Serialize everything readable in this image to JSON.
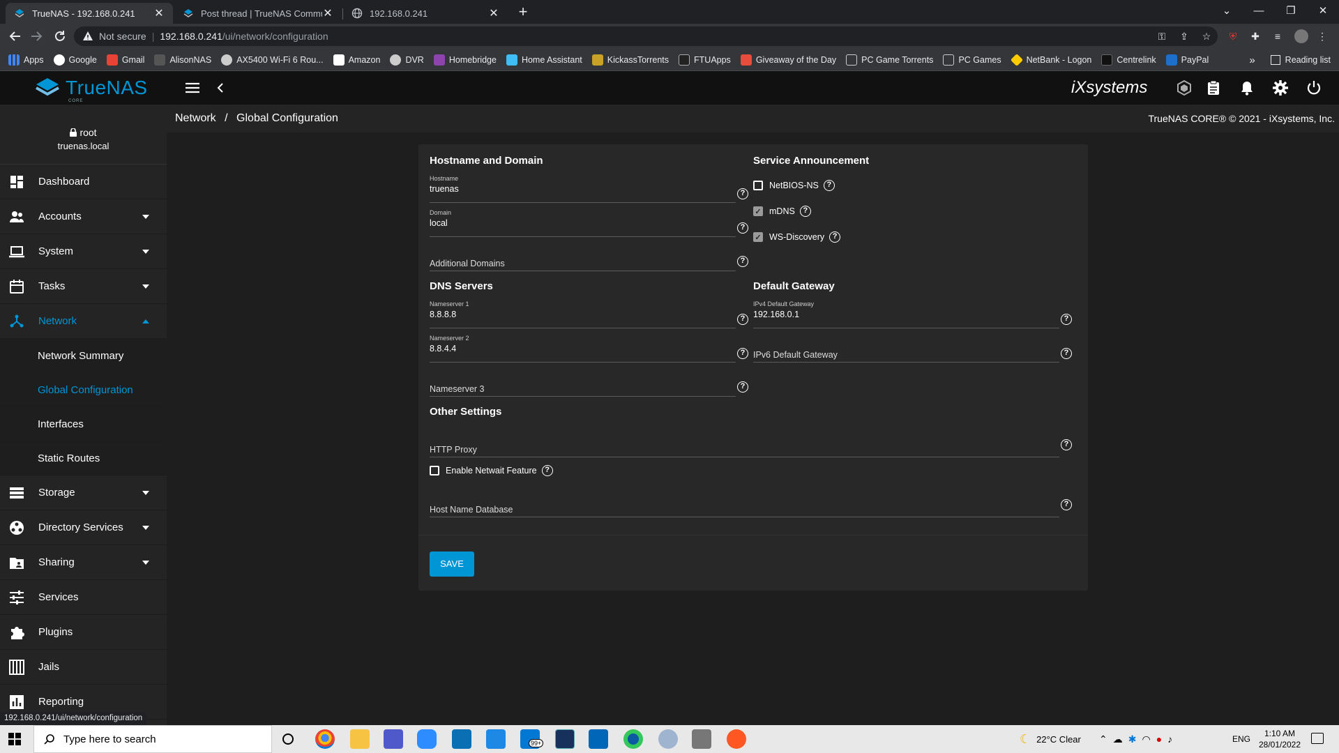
{
  "browser": {
    "tabs": [
      {
        "title": "TrueNAS - 192.168.0.241",
        "active": true
      },
      {
        "title": "Post thread | TrueNAS Communit",
        "active": false
      },
      {
        "title": "192.168.0.241",
        "active": false
      }
    ],
    "new_tab": "+",
    "address": {
      "security": "Not secure",
      "host": "192.168.0.241",
      "path": "/ui/network/configuration"
    },
    "bookmarks": [
      "Apps",
      "Google",
      "Gmail",
      "AlisonNAS",
      "AX5400 Wi-Fi 6 Rou...",
      "Amazon",
      "DVR",
      "Homebridge",
      "Home Assistant",
      "KickassTorrents",
      "FTUApps",
      "Giveaway of the Day",
      "PC Game Torrents",
      "PC Games",
      "NetBank - Logon",
      "Centrelink",
      "PayPal"
    ],
    "bookmarks_more": "»",
    "reading_list": "Reading list",
    "status_url": "192.168.0.241/ui/network/configuration"
  },
  "header": {
    "logo": "TrueNAS",
    "logo_sub": "CORE",
    "brand": "iXsystems"
  },
  "breadcrumb": {
    "parent": "Network",
    "sep": "/",
    "current": "Global Configuration"
  },
  "copyright": "TrueNAS CORE® © 2021 - iXsystems, Inc.",
  "user": {
    "name": "root",
    "host": "truenas.local"
  },
  "sidebar": {
    "items": [
      {
        "label": "Dashboard",
        "icon": "dashboard-icon"
      },
      {
        "label": "Accounts",
        "icon": "accounts-icon",
        "expandable": true
      },
      {
        "label": "System",
        "icon": "system-icon",
        "expandable": true
      },
      {
        "label": "Tasks",
        "icon": "tasks-icon",
        "expandable": true
      },
      {
        "label": "Network",
        "icon": "network-icon",
        "expanded": true
      },
      {
        "label": "Storage",
        "icon": "storage-icon",
        "expandable": true
      },
      {
        "label": "Directory Services",
        "icon": "directory-icon",
        "expandable": true
      },
      {
        "label": "Sharing",
        "icon": "sharing-icon",
        "expandable": true
      },
      {
        "label": "Services",
        "icon": "services-icon"
      },
      {
        "label": "Plugins",
        "icon": "plugins-icon"
      },
      {
        "label": "Jails",
        "icon": "jails-icon"
      },
      {
        "label": "Reporting",
        "icon": "reporting-icon"
      }
    ],
    "network_sub": [
      "Network Summary",
      "Global Configuration",
      "Interfaces",
      "Static Routes"
    ]
  },
  "form": {
    "hostname_section": "Hostname and Domain",
    "hostname_label": "Hostname",
    "hostname_value": "truenas",
    "domain_label": "Domain",
    "domain_value": "local",
    "additional_domains": "Additional Domains",
    "service_section": "Service Announcement",
    "netbios": "NetBIOS-NS",
    "netbios_checked": false,
    "mdns": "mDNS",
    "mdns_checked": true,
    "wsd": "WS-Discovery",
    "wsd_checked": true,
    "dns_section": "DNS Servers",
    "ns1_label": "Nameserver 1",
    "ns1_value": "8.8.8.8",
    "ns2_label": "Nameserver 2",
    "ns2_value": "8.8.4.4",
    "ns3": "Nameserver 3",
    "gateway_section": "Default Gateway",
    "ipv4_label": "IPv4 Default Gateway",
    "ipv4_value": "192.168.0.1",
    "ipv6": "IPv6 Default Gateway",
    "other_section": "Other Settings",
    "http_proxy": "HTTP Proxy",
    "netwait": "Enable Netwait Feature",
    "netwait_checked": false,
    "hostdb": "Host Name Database",
    "save": "SAVE",
    "help_glyph": "?"
  },
  "taskbar": {
    "search_placeholder": "Type here to search",
    "weather": "22°C  Clear",
    "lang": "ENG",
    "time": "1:10 AM",
    "date": "28/01/2022",
    "mail_badge": "99+"
  },
  "colors": {
    "accent": "#0095d5",
    "background": "#1e1e1e",
    "card": "#282828",
    "sidebar": "#242424"
  }
}
